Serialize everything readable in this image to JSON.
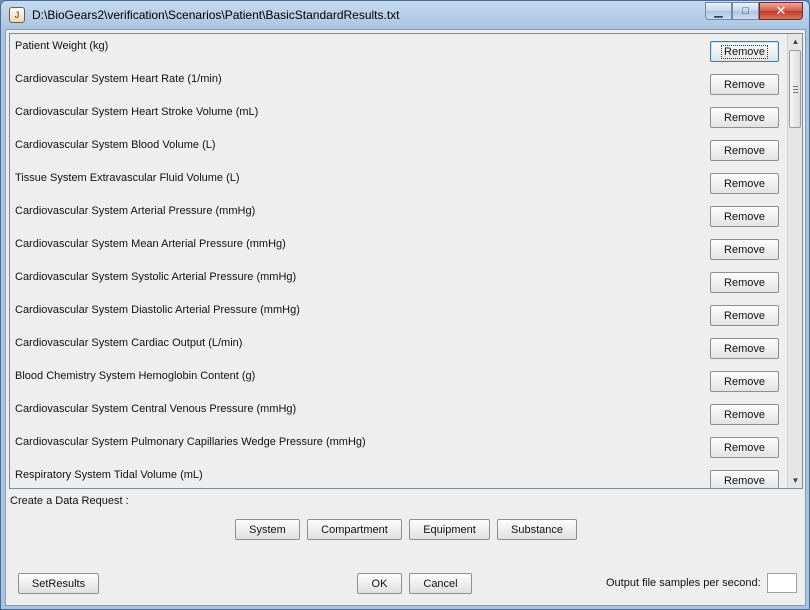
{
  "window": {
    "title": "D:\\BioGears2\\verification\\Scenarios\\Patient\\BasicStandardResults.txt",
    "minimize_glyph": "▁",
    "maximize_glyph": "□",
    "close_glyph": "✕",
    "app_icon_glyph": "J"
  },
  "list": {
    "rows": [
      {
        "label": "Patient Weight (kg)",
        "button": "Remove"
      },
      {
        "label": "Cardiovascular System Heart Rate (1/min)",
        "button": "Remove"
      },
      {
        "label": "Cardiovascular System Heart Stroke Volume (mL)",
        "button": "Remove"
      },
      {
        "label": "Cardiovascular System Blood Volume (L)",
        "button": "Remove"
      },
      {
        "label": "Tissue System Extravascular Fluid Volume (L)",
        "button": "Remove"
      },
      {
        "label": "Cardiovascular System Arterial Pressure (mmHg)",
        "button": "Remove"
      },
      {
        "label": "Cardiovascular System Mean Arterial Pressure (mmHg)",
        "button": "Remove"
      },
      {
        "label": "Cardiovascular System Systolic Arterial Pressure (mmHg)",
        "button": "Remove"
      },
      {
        "label": "Cardiovascular System Diastolic Arterial Pressure (mmHg)",
        "button": "Remove"
      },
      {
        "label": "Cardiovascular System Cardiac Output (L/min)",
        "button": "Remove"
      },
      {
        "label": "Blood Chemistry System Hemoglobin Content (g)",
        "button": "Remove"
      },
      {
        "label": "Cardiovascular System Central Venous Pressure (mmHg)",
        "button": "Remove"
      },
      {
        "label": "Cardiovascular System Pulmonary Capillaries Wedge Pressure (mmHg)",
        "button": "Remove"
      },
      {
        "label": "Respiratory System Tidal Volume (mL)",
        "button": "Remove"
      }
    ],
    "scroll_up_glyph": "▲",
    "scroll_down_glyph": "▼"
  },
  "request": {
    "label": "Create a Data Request :",
    "buttons": {
      "system": "System",
      "compartment": "Compartment",
      "equipment": "Equipment",
      "substance": "Substance"
    }
  },
  "footer": {
    "set_results": "SetResults",
    "ok": "OK",
    "cancel": "Cancel",
    "samples_label": "Output file samples per second:",
    "samples_value": ""
  }
}
